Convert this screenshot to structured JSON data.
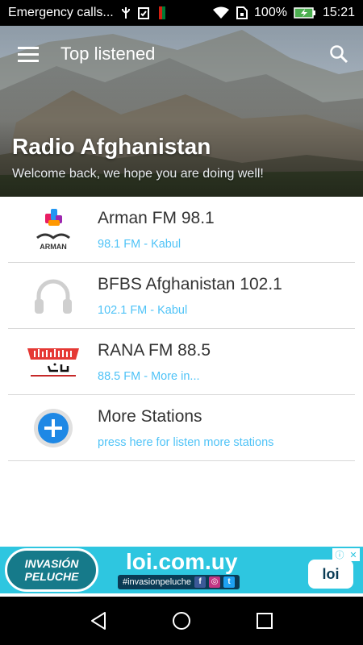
{
  "status_bar": {
    "notification_text": "Emergency calls...",
    "battery": "100%",
    "time": "15:21"
  },
  "toolbar": {
    "title": "Top listened"
  },
  "header": {
    "title": "Radio Afghanistan",
    "subtitle": "Welcome back, we hope you are doing well!"
  },
  "stations": [
    {
      "name": "Arman FM 98.1",
      "sub": "98.1 FM - Kabul",
      "logo_text": "ARMAN"
    },
    {
      "name": "BFBS Afghanistan 102.1",
      "sub": "102.1 FM - Kabul"
    },
    {
      "name": "RANA FM 88.5",
      "sub": "88.5 FM - More in..."
    },
    {
      "name": "More Stations",
      "sub": "press here for listen more stations"
    }
  ],
  "ad": {
    "left_line1": "INVASIÓN",
    "left_line2": "PELUCHE",
    "url": "loi.com.uy",
    "hashtag": "#invasionpeluche",
    "logo": "loi"
  },
  "colors": {
    "accent": "#4fc3f7",
    "ad_bg": "#2ec6e0",
    "more_button": "#1e88e5"
  }
}
